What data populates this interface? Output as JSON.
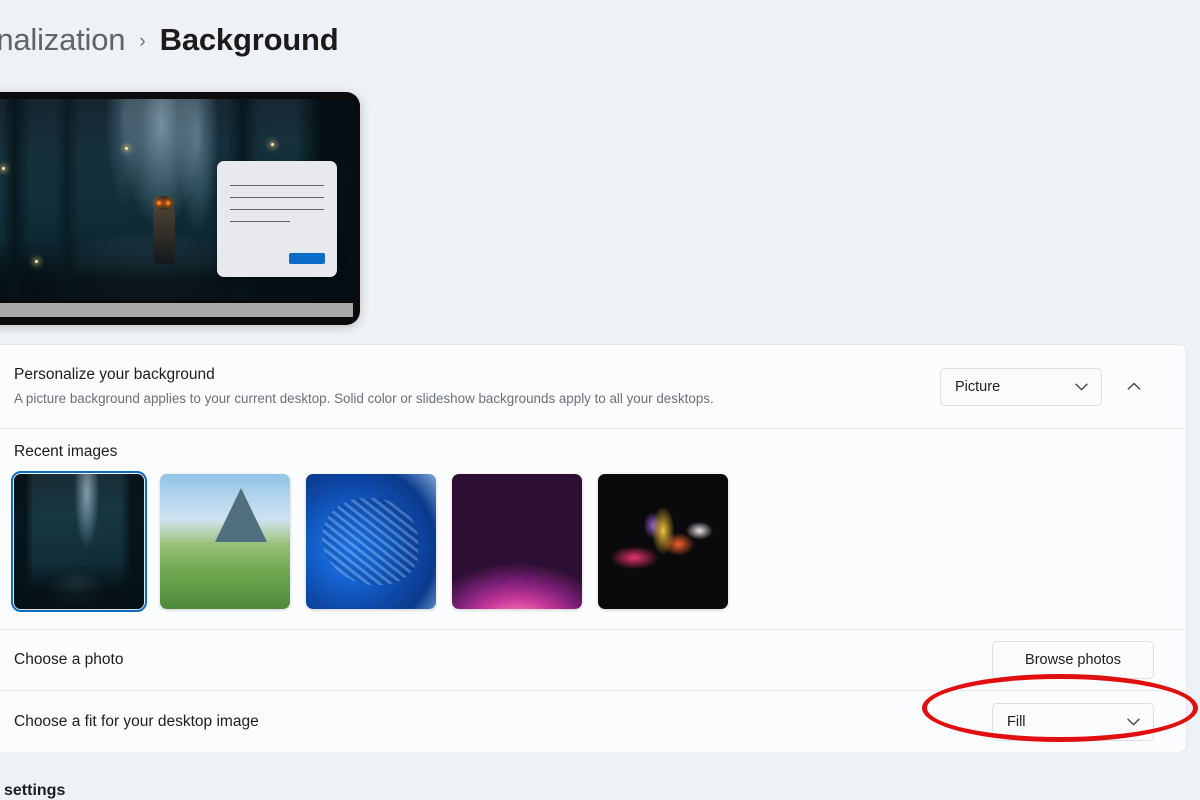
{
  "breadcrumb": {
    "parent": "sonalization",
    "separator": "›",
    "current": "Background"
  },
  "preview": {
    "name": "desktop-preview",
    "wallpaper_description": "Dark forest scene with character and fireflies"
  },
  "card": {
    "personalize": {
      "title": "Personalize your background",
      "subtitle": "A picture background applies to your current desktop. Solid color or slideshow backgrounds apply to all your desktops.",
      "dropdown_value": "Picture",
      "dropdown_chevron": "chevron-down-icon",
      "collapse_chevron": "chevron-up-icon"
    },
    "recent_images": {
      "label": "Recent images",
      "thumbnails": [
        {
          "name": "forest-night-wallpaper",
          "selected": true
        },
        {
          "name": "mountain-valley-wallpaper",
          "selected": false
        },
        {
          "name": "windows-bloom-blue-wallpaper",
          "selected": false
        },
        {
          "name": "purple-glow-sphere-wallpaper",
          "selected": false
        },
        {
          "name": "abstract-petals-wallpaper",
          "selected": false
        }
      ]
    },
    "choose_photo": {
      "label": "Choose a photo",
      "button_label": "Browse photos"
    },
    "choose_fit": {
      "label": "Choose a fit for your desktop image",
      "dropdown_value": "Fill",
      "dropdown_chevron": "chevron-down-icon"
    }
  },
  "annotation": {
    "name": "red-highlight-ellipse",
    "color": "#e01010",
    "target": "Fill"
  },
  "bottom": {
    "text": "settings"
  }
}
